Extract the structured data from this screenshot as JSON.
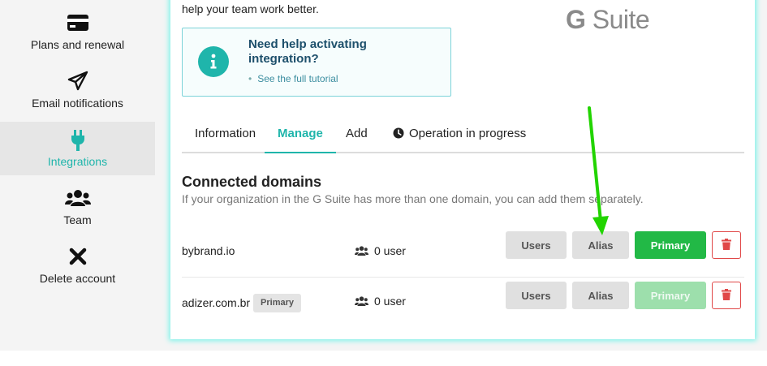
{
  "sidebar": {
    "items": [
      {
        "label": "Plans and renewal",
        "icon": "credit-card-icon"
      },
      {
        "label": "Email notifications",
        "icon": "paper-plane-icon"
      },
      {
        "label": "Integrations",
        "icon": "plug-icon",
        "active": true
      },
      {
        "label": "Team",
        "icon": "users-icon"
      },
      {
        "label": "Delete account",
        "icon": "close-icon"
      }
    ]
  },
  "intro_text": "help your team work better.",
  "logo": {
    "g": "G",
    "suite": "Suite"
  },
  "help": {
    "title": "Need help activating integration?",
    "link": "See the full tutorial",
    "icon": "info-icon"
  },
  "tabs": [
    {
      "label": "Information"
    },
    {
      "label": "Manage",
      "active": true
    },
    {
      "label": "Add"
    },
    {
      "label": "Operation in progress",
      "icon": "clock-icon"
    }
  ],
  "section": {
    "title": "Connected domains",
    "subtitle": "If your organization in the G Suite has more than one domain, you can add them separately."
  },
  "domains": [
    {
      "name": "bybrand.io",
      "badge": "",
      "users": "0 user",
      "users_btn": "Users",
      "alias_btn": "Alias",
      "primary_btn": "Primary",
      "primary_enabled": true
    },
    {
      "name": "adizer.com.br",
      "badge": "Primary",
      "users": "0 user",
      "users_btn": "Users",
      "alias_btn": "Alias",
      "primary_btn": "Primary",
      "primary_enabled": false
    }
  ],
  "colors": {
    "accent": "#1fb5ab",
    "primary_green": "#22b946",
    "danger": "#e04848",
    "annotation_arrow": "#22d400"
  }
}
